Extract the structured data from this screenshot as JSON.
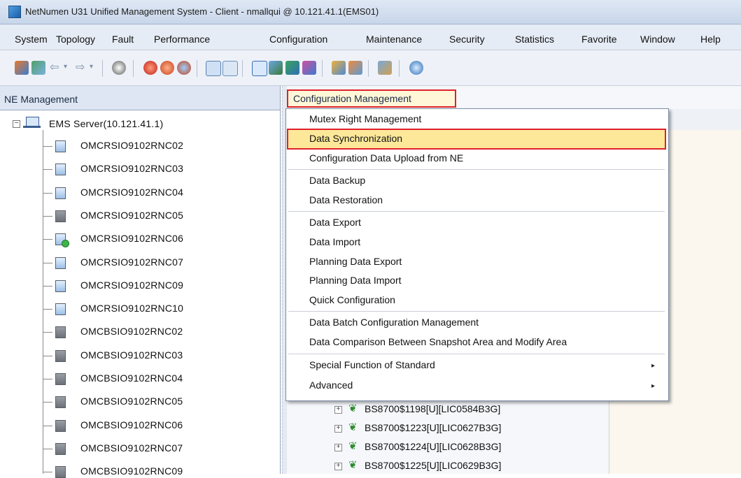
{
  "window": {
    "title": "NetNumen U31 Unified Management System - Client - nmallqui @ 10.121.41.1(EMS01)"
  },
  "menubar": {
    "items": [
      "System",
      "Topology",
      "Fault",
      "Performance",
      "Configuration",
      "Maintenance",
      "Security",
      "Statistics",
      "Favorite",
      "Window",
      "Help"
    ]
  },
  "left_panel": {
    "tab_label": "NE Management",
    "root_label": "EMS Server(10.121.41.1)",
    "nodes": [
      "OMCRSIO9102RNC02",
      "OMCRSIO9102RNC03",
      "OMCRSIO9102RNC04",
      "OMCRSIO9102RNC05",
      "OMCRSIO9102RNC06",
      "OMCRSIO9102RNC07",
      "OMCRSIO9102RNC09",
      "OMCRSIO9102RNC10",
      "OMCBSIO9102RNC02",
      "OMCBSIO9102RNC03",
      "OMCBSIO9102RNC04",
      "OMCBSIO9102RNC05",
      "OMCBSIO9102RNC06",
      "OMCBSIO9102RNC07",
      "OMCBSIO9102RNC09"
    ]
  },
  "right_panel": {
    "tab_label": "Configuration Management",
    "background_items": [
      "BS8700$1198[U][LIC0584B3G]",
      "BS8700$1223[U][LIC0627B3G]",
      "BS8700$1224[U][LIC0628B3G]",
      "BS8700$1225[U][LIC0629B3G]"
    ]
  },
  "dropdown": {
    "items": [
      "Mutex Right Management",
      "Data Synchronization",
      "Configuration Data Upload from NE",
      "Data Backup",
      "Data Restoration",
      "Data Export",
      "Data Import",
      "Planning Data Export",
      "Planning Data Import",
      "Quick Configuration",
      "Data Batch Configuration Management",
      "Data Comparison Between Snapshot Area and Modify Area",
      "Special Function of Standard",
      "Advanced"
    ],
    "highlighted": "Data Synchronization",
    "submenu_items": [
      "Special Function of Standard",
      "Advanced"
    ]
  },
  "colors": {
    "highlight": "#fde89a",
    "annotation_red": "#e0202b",
    "tree_leaf_green": "#2e8b2e"
  },
  "icons": {
    "submenu_arrow": "▸",
    "tree_expander": "⊞",
    "leaf": "❦"
  }
}
